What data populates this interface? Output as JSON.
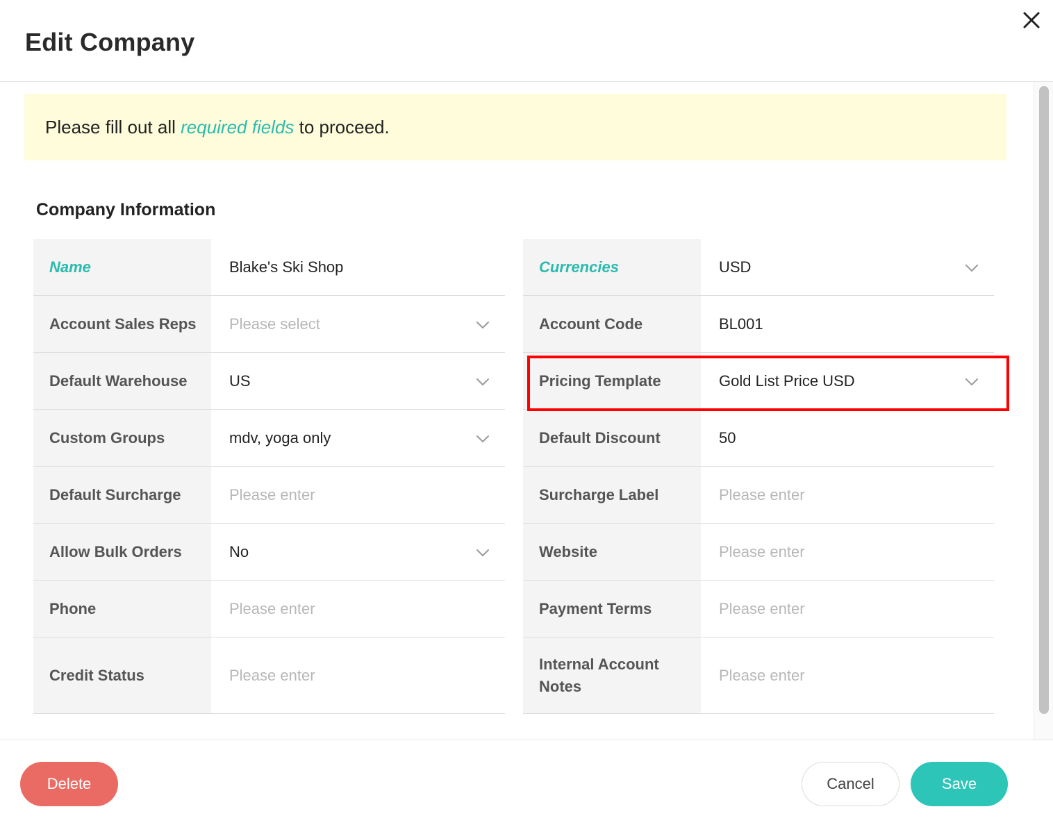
{
  "modal": {
    "title": "Edit Company",
    "close_icon": "close-icon"
  },
  "notice": {
    "prefix": "Please fill out all ",
    "link": "required fields",
    "suffix": " to proceed."
  },
  "section": {
    "title": "Company Information"
  },
  "left_fields": [
    {
      "label": "Name",
      "value": "Blake's Ski Shop",
      "required": true,
      "dropdown": false,
      "placeholder": false
    },
    {
      "label": "Account Sales Reps",
      "value": "Please select",
      "required": false,
      "dropdown": true,
      "placeholder": true
    },
    {
      "label": "Default Warehouse",
      "value": "US",
      "required": false,
      "dropdown": true,
      "placeholder": false
    },
    {
      "label": "Custom Groups",
      "value": "mdv, yoga only",
      "required": false,
      "dropdown": true,
      "placeholder": false
    },
    {
      "label": "Default Surcharge",
      "value": "Please enter",
      "required": false,
      "dropdown": false,
      "placeholder": true
    },
    {
      "label": "Allow Bulk Orders",
      "value": "No",
      "required": false,
      "dropdown": true,
      "placeholder": false
    },
    {
      "label": "Phone",
      "value": "Please enter",
      "required": false,
      "dropdown": false,
      "placeholder": true
    },
    {
      "label": "Credit Status",
      "value": "Please enter",
      "required": false,
      "dropdown": false,
      "placeholder": true
    }
  ],
  "right_fields": [
    {
      "label": "Currencies",
      "value": "USD",
      "required": true,
      "dropdown": true,
      "placeholder": false
    },
    {
      "label": "Account Code",
      "value": "BL001",
      "required": false,
      "dropdown": false,
      "placeholder": false
    },
    {
      "label": "Pricing Template",
      "value": "Gold List Price USD",
      "required": false,
      "dropdown": true,
      "placeholder": false
    },
    {
      "label": "Default Discount",
      "value": "50",
      "required": false,
      "dropdown": false,
      "placeholder": false
    },
    {
      "label": "Surcharge Label",
      "value": "Please enter",
      "required": false,
      "dropdown": false,
      "placeholder": true
    },
    {
      "label": "Website",
      "value": "Please enter",
      "required": false,
      "dropdown": false,
      "placeholder": true
    },
    {
      "label": "Payment Terms",
      "value": "Please enter",
      "required": false,
      "dropdown": false,
      "placeholder": true
    },
    {
      "label": "Internal Account Notes",
      "value": "Please enter",
      "required": false,
      "dropdown": false,
      "placeholder": true
    }
  ],
  "footer": {
    "delete_label": "Delete",
    "cancel_label": "Cancel",
    "save_label": "Save"
  },
  "colors": {
    "accent": "#2bbbad",
    "save": "#2ec5b9",
    "delete": "#ea6b63",
    "notice_bg": "#fefcdb",
    "highlight": "#ff0000"
  }
}
